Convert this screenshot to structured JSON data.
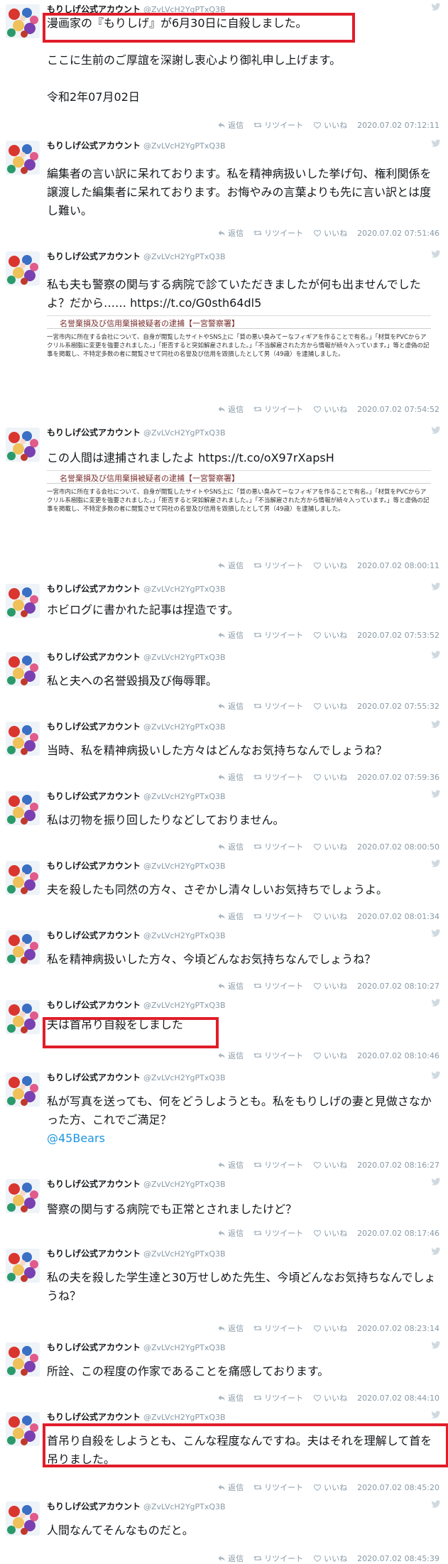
{
  "colors": {
    "highlight": "#e01e2a",
    "link": "#1b95e0",
    "meta": "#8899a6"
  },
  "labels": {
    "reply": "返信",
    "retweet": "リツイート",
    "like": "いいね"
  },
  "tweets": [
    {
      "name": "もりしげ公式アカウント",
      "handle": "@ZvLVcH2YgPTxQ3B",
      "text": "漫画家の『もりしげ』が6月30日に自殺しました。\n\nここに生前のご厚誼を深謝し衷心より御礼申し上げます。\n\n令和2年07月02日",
      "time": "2020.07.02 07:12:11"
    },
    {
      "name": "もりしげ公式アカウント",
      "handle": "@ZvLVcH2YgPTxQ3B",
      "text": "編集者の言い訳に呆れております。私を精神病扱いした挙げ句、権利関係を譲渡した編集者に呆れております。お悔やみの言葉よりも先に言い訳とは度し難い。",
      "time": "2020.07.02 07:51:46"
    },
    {
      "name": "もりしげ公式アカウント",
      "handle": "@ZvLVcH2YgPTxQ3B",
      "text": "私も夫も警察の関与する病院で診ていただきましたが何も出ませんでしたよ？だから…… https://t.co/G0sth64dl5",
      "card_title": "名誉棄損及び信用棄損被疑者の逮捕【一宮警察署】",
      "card_body": "一宮市内に所在する会社について、自身が閲覧したサイトやSNS上に「質の悪い臭みてーなフィギアを作ることで有名。」「材質をPVCからアクリル系樹脂に変更を強要されました。」「拒否すると突如解雇されました。」「不当解雇された方から情報が続々入っています。」等と虚偽の記事を掲載し、不特定多数の者に閲覧させて同社の名誉及び信用を毀損したとして男（49歳）を逮捕しました。",
      "time": "2020.07.02 07:54:52"
    },
    {
      "name": "もりしげ公式アカウント",
      "handle": "@ZvLVcH2YgPTxQ3B",
      "text": "この人間は逮捕されましたよ https://t.co/oX97rXapsH",
      "card_title": "名誉棄損及び信用棄損被疑者の逮捕【一宮警察署】",
      "card_body": "一宮市内に所在する会社について、自身が閲覧したサイトやSNS上に「質の悪い臭みてーなフィギアを作ることで有名。」「材質をPVCからアクリル系樹脂に変更を強要されました。」「拒否すると突如解雇されました。」「不当解雇された方から情報が続々入っています。」等と虚偽の記事を掲載し、不特定多数の者に閲覧させて同社の名誉及び信用を毀損したとして男（49歳）を逮捕しました。",
      "time": "2020.07.02 08:00:11"
    },
    {
      "name": "もりしげ公式アカウント",
      "handle": "@ZvLVcH2YgPTxQ3B",
      "text": "ホビログに書かれた記事は捏造です。",
      "time": "2020.07.02 07:53:52"
    },
    {
      "name": "もりしげ公式アカウント",
      "handle": "@ZvLVcH2YgPTxQ3B",
      "text": "私と夫への名誉毀損及び侮辱罪。",
      "time": "2020.07.02 07:55:32"
    },
    {
      "name": "もりしげ公式アカウント",
      "handle": "@ZvLVcH2YgPTxQ3B",
      "text": "当時、私を精神病扱いした方々はどんなお気持ちなんでしょうね？",
      "time": "2020.07.02 07:59:36"
    },
    {
      "name": "もりしげ公式アカウント",
      "handle": "@ZvLVcH2YgPTxQ3B",
      "text": "私は刃物を振り回したりなどしておりません。",
      "time": "2020.07.02 08:00:50"
    },
    {
      "name": "もりしげ公式アカウント",
      "handle": "@ZvLVcH2YgPTxQ3B",
      "text": "夫を殺したも同然の方々、さぞかし清々しいお気持ちでしょうよ。",
      "time": "2020.07.02 08:01:34"
    },
    {
      "name": "もりしげ公式アカウント",
      "handle": "@ZvLVcH2YgPTxQ3B",
      "text": "私を精神病扱いした方々、今頃どんなお気持ちなんでしょうね？",
      "time": "2020.07.02 08:10:27"
    },
    {
      "name": "もりしげ公式アカウント",
      "handle": "@ZvLVcH2YgPTxQ3B",
      "text": "夫は首吊り自殺をしました",
      "time": "2020.07.02 08:10:46"
    },
    {
      "name": "もりしげ公式アカウント",
      "handle": "@ZvLVcH2YgPTxQ3B",
      "text": "私が写真を送っても、何をどうしようとも。私をもりしげの妻と見做さなかった方、これでご満足？",
      "mention": "@45Bears",
      "time": "2020.07.02 08:16:27"
    },
    {
      "name": "もりしげ公式アカウント",
      "handle": "@ZvLVcH2YgPTxQ3B",
      "text": "警察の関与する病院でも正常とされましたけど？",
      "time": "2020.07.02 08:17:46"
    },
    {
      "name": "もりしげ公式アカウント",
      "handle": "@ZvLVcH2YgPTxQ3B",
      "text": "私の夫を殺した学生達と30万せしめた先生、今頃どんなお気持ちなんでしょうね？",
      "time": "2020.07.02 08:23:14"
    },
    {
      "name": "もりしげ公式アカウント",
      "handle": "@ZvLVcH2YgPTxQ3B",
      "text": "所詮、この程度の作家であることを痛感しております。",
      "time": "2020.07.02 08:44:10"
    },
    {
      "name": "もりしげ公式アカウント",
      "handle": "@ZvLVcH2YgPTxQ3B",
      "text": "首吊り自殺をしようとも、こんな程度なんですね。夫はそれを理解して首を吊りました。",
      "time": "2020.07.02 08:45:20"
    },
    {
      "name": "もりしげ公式アカウント",
      "handle": "@ZvLVcH2YgPTxQ3B",
      "text": "人間なんてそんなものだと。",
      "time": "2020.07.02 08:45:39"
    }
  ]
}
